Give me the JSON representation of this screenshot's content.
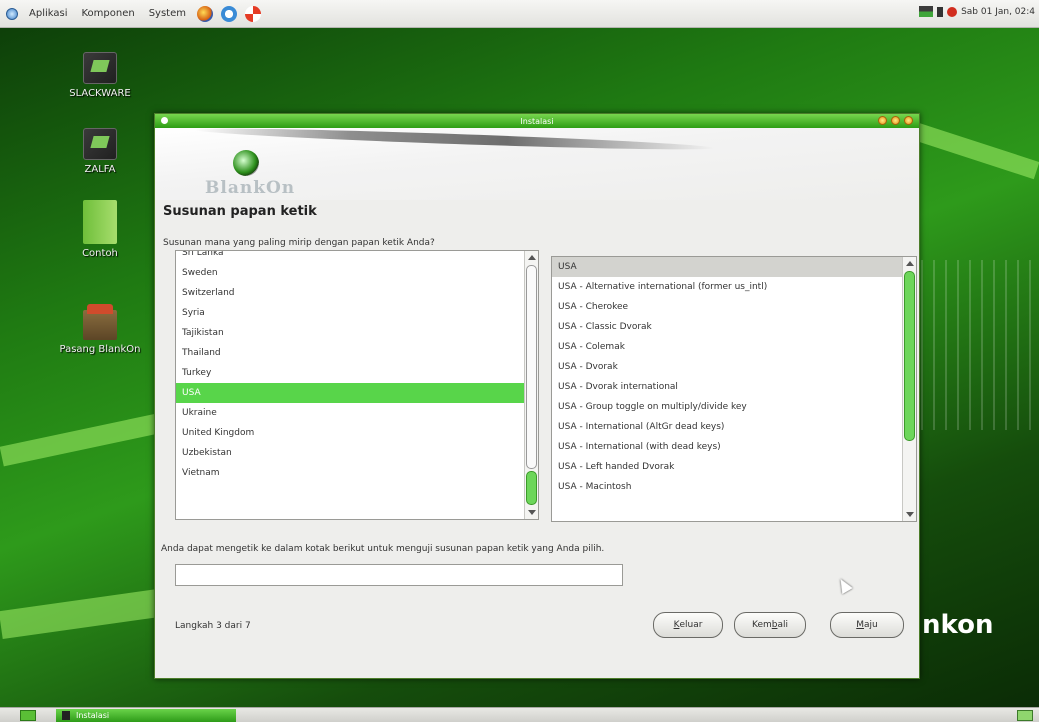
{
  "top_panel": {
    "menu": [
      "Aplikasi",
      "Komponen",
      "System"
    ],
    "clock": "Sab 01 Jan, 02:4"
  },
  "desktop": {
    "icons": [
      "SLACKWARE",
      "ZALFA",
      "Contoh",
      "Pasang BlankOn"
    ],
    "brand": "nkon"
  },
  "window": {
    "title": "Instalasi",
    "logo": "BlankOn",
    "heading": "Susunan papan ketik",
    "question": "Susunan mana yang paling mirip dengan papan ketik Anda?",
    "countries": [
      "Sri Lanka",
      "Sweden",
      "Switzerland",
      "Syria",
      "Tajikistan",
      "Thailand",
      "Turkey",
      "USA",
      "Ukraine",
      "United Kingdom",
      "Uzbekistan",
      "Vietnam"
    ],
    "selected_country": "USA",
    "variants": [
      "USA",
      "USA - Alternative international (former us_intl)",
      "USA - Cherokee",
      "USA - Classic Dvorak",
      "USA - Colemak",
      "USA - Dvorak",
      "USA - Dvorak international",
      "USA - Group toggle on multiply/divide key",
      "USA - International (AltGr dead keys)",
      "USA - International (with dead keys)",
      "USA - Left handed Dvorak",
      "USA - Macintosh"
    ],
    "selected_variant": "USA",
    "test_label": "Anda dapat mengetik ke dalam kotak berikut untuk menguji susunan papan ketik yang Anda pilih.",
    "test_input_value": "",
    "step": "Langkah 3 dari 7",
    "buttons": {
      "quit_prefix": "",
      "quit_ul": "K",
      "quit_rest": "eluar",
      "back_prefix": "Kem",
      "back_ul": "b",
      "back_rest": "ali",
      "next_prefix": "",
      "next_ul": "M",
      "next_rest": "aju"
    }
  },
  "taskbar": {
    "task": "Instalasi"
  },
  "colors": {
    "accent": "#58d54a",
    "titlebar": "#2d9d14"
  }
}
